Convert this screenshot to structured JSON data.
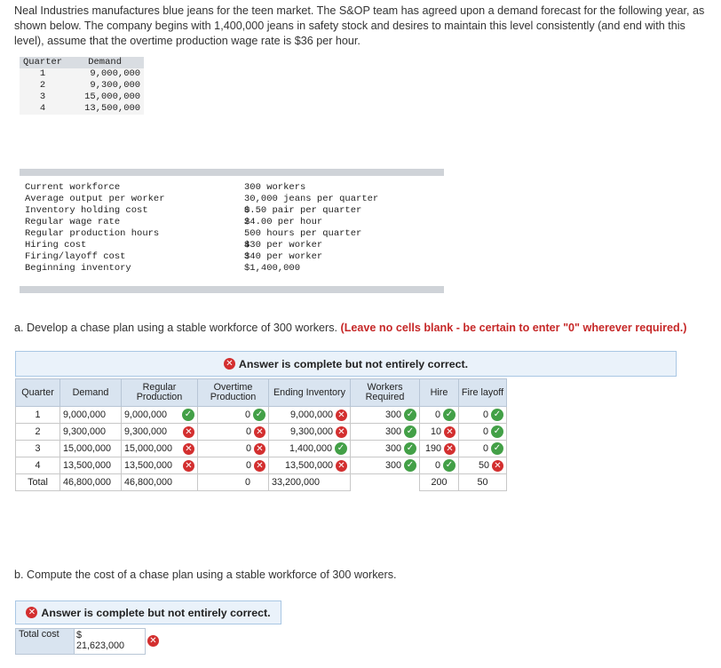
{
  "intro": "Neal Industries manufactures blue jeans for the teen market. The S&OP team has agreed upon a demand forecast for the following year, as shown below. The company begins with 1,400,000 jeans in safety stock and desires to maintain this level consistently (and end with this level), assume that the overtime production wage rate is $36 per hour.",
  "demand_table": {
    "headers": [
      "Quarter",
      "Demand"
    ],
    "rows": [
      [
        "1",
        "9,000,000"
      ],
      [
        "2",
        "9,300,000"
      ],
      [
        "3",
        "15,000,000"
      ],
      [
        "4",
        "13,500,000"
      ]
    ]
  },
  "params": [
    {
      "label": "Current workforce",
      "dollar": "",
      "value": "300 workers"
    },
    {
      "label": "Average output per worker",
      "dollar": "",
      "value": "30,000 jeans per quarter"
    },
    {
      "label": "Inventory holding cost",
      "dollar": "$",
      "value": "0.50 pair per quarter"
    },
    {
      "label": "Regular wage rate",
      "dollar": "$",
      "value": "24.00 per hour"
    },
    {
      "label": "Regular production hours",
      "dollar": "",
      "value": "500 hours per quarter"
    },
    {
      "label": "Hiring cost",
      "dollar": "$",
      "value": "430 per worker"
    },
    {
      "label": "Firing/layoff cost",
      "dollar": "$",
      "value": "340 per worker"
    },
    {
      "label": "Beginning inventory",
      "dollar": "",
      "value": "$1,400,000"
    }
  ],
  "part_a": {
    "text": "a. Develop a chase plan using a stable workforce of 300 workers.",
    "note": "(Leave no cells blank - be certain to enter \"0\" wherever required.)",
    "banner": "Answer is complete but not entirely correct."
  },
  "chase_table": {
    "headers": [
      "Quarter",
      "Demand",
      "Regular Production",
      "Overtime Production",
      "Ending Inventory",
      "Workers Required",
      "Hire",
      "Fire layoff"
    ],
    "rows": [
      {
        "q": "1",
        "demand": "9,000,000",
        "reg": "9,000,000",
        "reg_ok": true,
        "ot": "0",
        "ot_ok": true,
        "end": "9,000,000",
        "end_ok": false,
        "workers": "300",
        "workers_ok": true,
        "hire": "0",
        "hire_ok": true,
        "fire": "0",
        "fire_ok": true
      },
      {
        "q": "2",
        "demand": "9,300,000",
        "reg": "9,300,000",
        "reg_ok": false,
        "ot": "0",
        "ot_ok": false,
        "end": "9,300,000",
        "end_ok": false,
        "workers": "300",
        "workers_ok": true,
        "hire": "10",
        "hire_ok": false,
        "fire": "0",
        "fire_ok": true
      },
      {
        "q": "3",
        "demand": "15,000,000",
        "reg": "15,000,000",
        "reg_ok": false,
        "ot": "0",
        "ot_ok": false,
        "end": "1,400,000",
        "end_ok": true,
        "workers": "300",
        "workers_ok": true,
        "hire": "190",
        "hire_ok": false,
        "fire": "0",
        "fire_ok": true
      },
      {
        "q": "4",
        "demand": "13,500,000",
        "reg": "13,500,000",
        "reg_ok": false,
        "ot": "0",
        "ot_ok": false,
        "end": "13,500,000",
        "end_ok": false,
        "workers": "300",
        "workers_ok": true,
        "hire": "0",
        "hire_ok": true,
        "fire": "50",
        "fire_ok": false
      }
    ],
    "total": {
      "label": "Total",
      "demand": "46,800,000",
      "reg": "46,800,000",
      "ot": "0",
      "end": "33,200,000",
      "hire": "200",
      "fire": "50"
    }
  },
  "part_b": {
    "text": "b. Compute the cost of a chase plan using a stable workforce of 300 workers.",
    "banner": "Answer is complete but not entirely correct.",
    "cost_label": "Total cost",
    "cost_currency": "$",
    "cost_value": "21,623,000"
  },
  "colors": {
    "correct": "#43a047",
    "incorrect": "#d32f2f",
    "header_bg": "#d9e4f0",
    "banner_bg": "#eaf2fa"
  }
}
